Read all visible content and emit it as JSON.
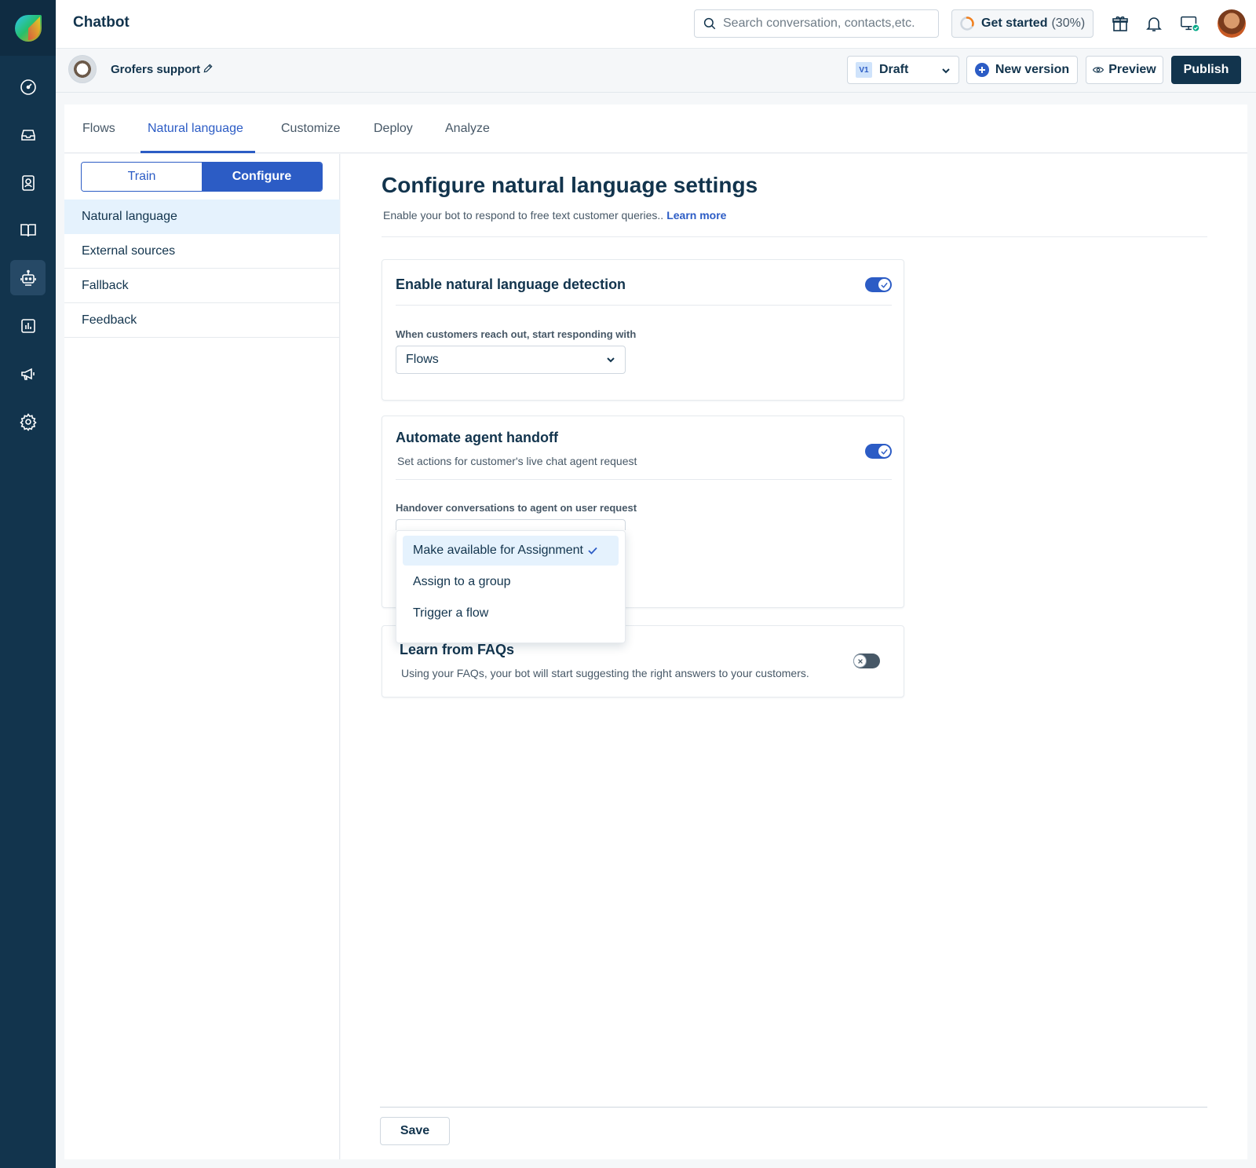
{
  "app": {
    "title": "Chatbot"
  },
  "header": {
    "search_placeholder": "Search conversation, contacts,etc.",
    "get_started_label": "Get started",
    "get_started_pct": "(30%)",
    "progress": 0.3
  },
  "rail": {
    "items": [
      "dashboard-icon",
      "inbox-icon",
      "contacts-icon",
      "knowledge-icon",
      "bot-icon",
      "reports-icon",
      "campaigns-icon",
      "settings-icon"
    ],
    "active": "bot-icon"
  },
  "subheader": {
    "bot_name": "Grofers support",
    "version_badge": "V1",
    "version_state": "Draft",
    "new_version_label": "New version",
    "preview_label": "Preview",
    "publish_label": "Publish"
  },
  "tabs": [
    "Flows",
    "Natural language",
    "Customize",
    "Deploy",
    "Analyze"
  ],
  "active_tab": "Natural language",
  "sidebar": {
    "segment": {
      "train": "Train",
      "configure": "Configure",
      "active": "Configure"
    },
    "items": [
      "Natural language",
      "External sources",
      "Fallback",
      "Feedback"
    ],
    "active": "Natural language"
  },
  "main": {
    "title": "Configure natural language settings",
    "subtitle": "Enable your bot to respond to free text customer queries..",
    "learn_more": "Learn more",
    "cards": {
      "detection": {
        "title": "Enable natural language detection",
        "enabled": true,
        "field_label": "When customers reach out, start responding with",
        "field_value": "Flows"
      },
      "handoff": {
        "title": "Automate agent handoff",
        "description": "Set actions for customer's live chat agent request",
        "enabled": true,
        "field_label": "Handover conversations to agent on user request",
        "field_value": "Make available for Assignment",
        "options": [
          "Make available for Assignment",
          "Assign to a group",
          "Trigger a flow"
        ]
      },
      "faqs": {
        "title": "Learn from FAQs",
        "description": "Using your FAQs, your bot will start suggesting the right answers to your customers.",
        "enabled": false
      }
    },
    "save_label": "Save"
  },
  "colors": {
    "rail": "#12344d",
    "accent": "#2c5cc5",
    "primary_button": "#12344d",
    "selected_bg": "#e5f2fd"
  }
}
